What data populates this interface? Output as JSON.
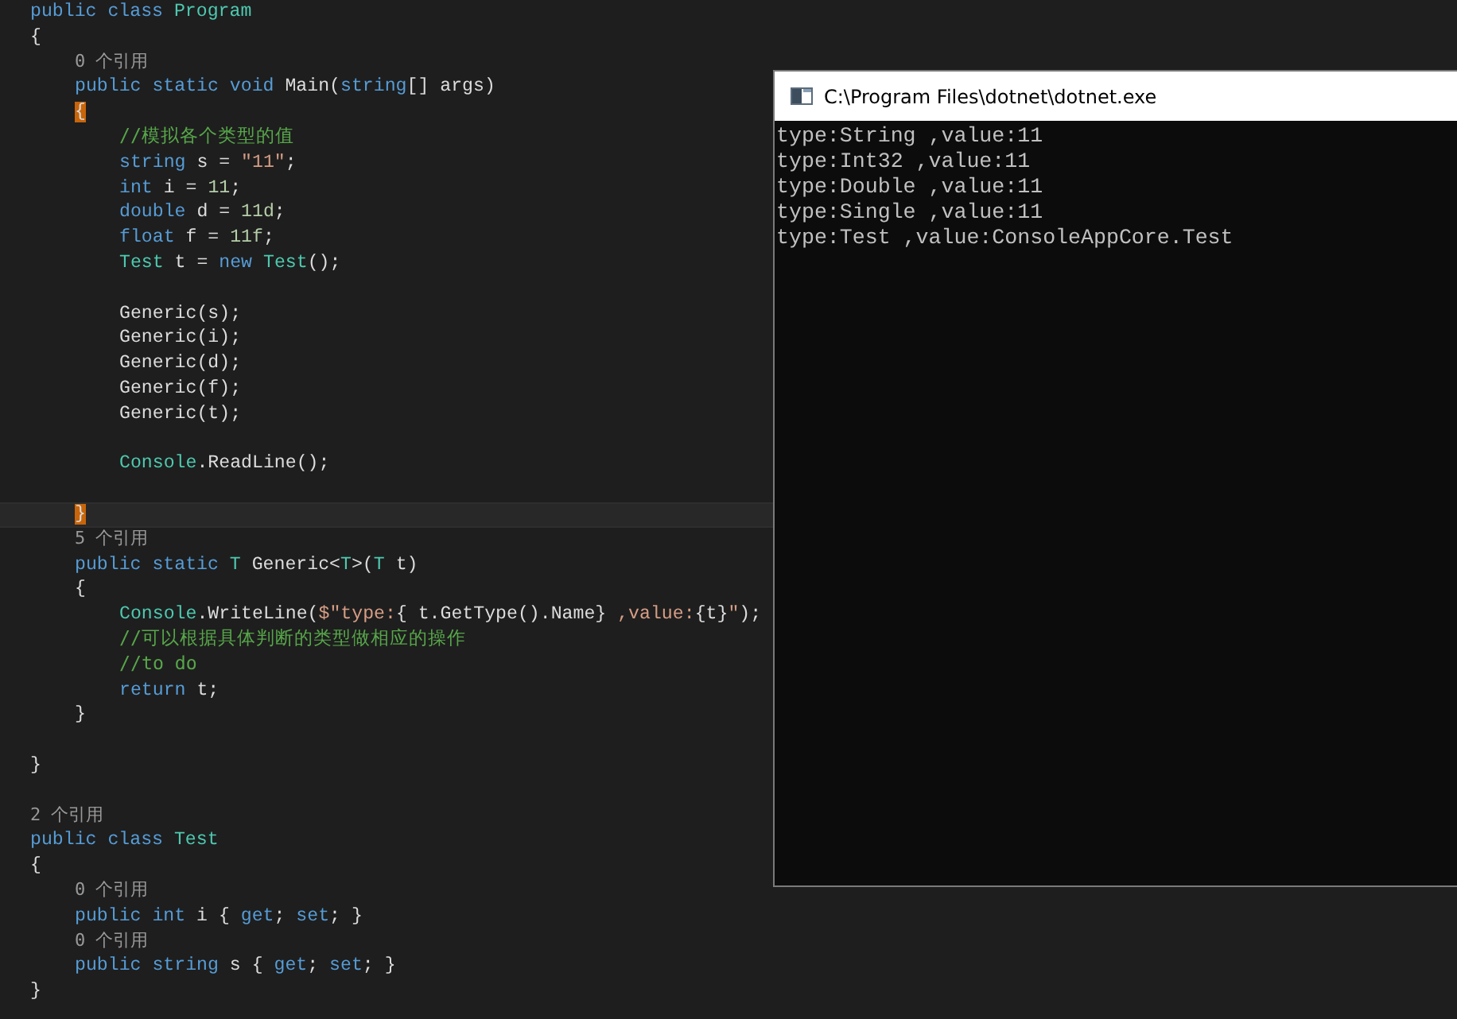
{
  "editor": {
    "lines": [
      {
        "kind": "code",
        "current": false,
        "tokens": [
          {
            "kind": "keyword",
            "text": "public class "
          },
          {
            "kind": "type",
            "text": "Program"
          }
        ]
      },
      {
        "kind": "code",
        "current": false,
        "tokens": [
          {
            "kind": "plain",
            "text": "{"
          }
        ],
        "children": [
          {
            "kind": "code",
            "current": false,
            "tokens": [
              {
                "kind": "lens",
                "text": "0 个引用"
              }
            ]
          },
          {
            "kind": "code",
            "current": false,
            "tokens": [
              {
                "kind": "keyword",
                "text": "public static void "
              },
              {
                "kind": "plain",
                "text": "Main("
              },
              {
                "kind": "keyword",
                "text": "string"
              },
              {
                "kind": "plain",
                "text": "[] args)"
              }
            ]
          },
          {
            "kind": "code",
            "current": false,
            "tokens": [
              {
                "kind": "brace-match",
                "text": "{"
              }
            ],
            "children": [
              {
                "kind": "code",
                "current": false,
                "tokens": [
                  {
                    "kind": "comment",
                    "text": "//模拟各个类型的值"
                  }
                ]
              },
              {
                "kind": "code",
                "current": false,
                "tokens": [
                  {
                    "kind": "keyword",
                    "text": "string "
                  },
                  {
                    "kind": "plain",
                    "text": "s = "
                  },
                  {
                    "kind": "string",
                    "text": "\"11\""
                  },
                  {
                    "kind": "plain",
                    "text": ";"
                  }
                ]
              },
              {
                "kind": "code",
                "current": false,
                "tokens": [
                  {
                    "kind": "keyword",
                    "text": "int "
                  },
                  {
                    "kind": "plain",
                    "text": "i = "
                  },
                  {
                    "kind": "number",
                    "text": "11"
                  },
                  {
                    "kind": "plain",
                    "text": ";"
                  }
                ]
              },
              {
                "kind": "code",
                "current": false,
                "tokens": [
                  {
                    "kind": "keyword",
                    "text": "double "
                  },
                  {
                    "kind": "plain",
                    "text": "d = "
                  },
                  {
                    "kind": "number",
                    "text": "11d"
                  },
                  {
                    "kind": "plain",
                    "text": ";"
                  }
                ]
              },
              {
                "kind": "code",
                "current": false,
                "tokens": [
                  {
                    "kind": "keyword",
                    "text": "float "
                  },
                  {
                    "kind": "plain",
                    "text": "f = "
                  },
                  {
                    "kind": "number",
                    "text": "11f"
                  },
                  {
                    "kind": "plain",
                    "text": ";"
                  }
                ]
              },
              {
                "kind": "code",
                "current": false,
                "tokens": [
                  {
                    "kind": "type",
                    "text": "Test "
                  },
                  {
                    "kind": "plain",
                    "text": "t = "
                  },
                  {
                    "kind": "keyword",
                    "text": "new "
                  },
                  {
                    "kind": "type",
                    "text": "Test"
                  },
                  {
                    "kind": "plain",
                    "text": "();"
                  }
                ]
              },
              {
                "kind": "blank",
                "current": false
              },
              {
                "kind": "code",
                "current": false,
                "tokens": [
                  {
                    "kind": "plain",
                    "text": "Generic(s);"
                  }
                ]
              },
              {
                "kind": "code",
                "current": false,
                "tokens": [
                  {
                    "kind": "plain",
                    "text": "Generic(i);"
                  }
                ]
              },
              {
                "kind": "code",
                "current": false,
                "tokens": [
                  {
                    "kind": "plain",
                    "text": "Generic(d);"
                  }
                ]
              },
              {
                "kind": "code",
                "current": false,
                "tokens": [
                  {
                    "kind": "plain",
                    "text": "Generic(f);"
                  }
                ]
              },
              {
                "kind": "code",
                "current": false,
                "tokens": [
                  {
                    "kind": "plain",
                    "text": "Generic(t);"
                  }
                ]
              },
              {
                "kind": "blank",
                "current": false
              },
              {
                "kind": "code",
                "current": false,
                "tokens": [
                  {
                    "kind": "type",
                    "text": "Console"
                  },
                  {
                    "kind": "plain",
                    "text": ".ReadLine();"
                  }
                ]
              },
              {
                "kind": "blank",
                "current": false
              }
            ]
          },
          {
            "kind": "code",
            "current": true,
            "tokens": [
              {
                "kind": "brace-match",
                "text": "}"
              }
            ]
          },
          {
            "kind": "code",
            "current": false,
            "tokens": [
              {
                "kind": "lens",
                "text": "5 个引用"
              }
            ]
          },
          {
            "kind": "code",
            "current": false,
            "tokens": [
              {
                "kind": "keyword",
                "text": "public static "
              },
              {
                "kind": "type",
                "text": "T "
              },
              {
                "kind": "plain",
                "text": "Generic<"
              },
              {
                "kind": "type",
                "text": "T"
              },
              {
                "kind": "plain",
                "text": ">("
              },
              {
                "kind": "type",
                "text": "T "
              },
              {
                "kind": "plain",
                "text": "t)"
              }
            ]
          },
          {
            "kind": "code",
            "current": false,
            "tokens": [
              {
                "kind": "plain",
                "text": "{"
              }
            ],
            "children": [
              {
                "kind": "code",
                "current": false,
                "tokens": [
                  {
                    "kind": "type",
                    "text": "Console"
                  },
                  {
                    "kind": "plain",
                    "text": ".WriteLine("
                  },
                  {
                    "kind": "string",
                    "text": "$\"type:"
                  },
                  {
                    "kind": "plain",
                    "text": "{ t.GetType().Name}"
                  },
                  {
                    "kind": "string",
                    "text": " ,value:"
                  },
                  {
                    "kind": "plain",
                    "text": "{t}"
                  },
                  {
                    "kind": "string",
                    "text": "\""
                  },
                  {
                    "kind": "plain",
                    "text": ");"
                  }
                ]
              },
              {
                "kind": "code",
                "current": false,
                "tokens": [
                  {
                    "kind": "comment",
                    "text": "//可以根据具体判断的类型做相应的操作"
                  }
                ]
              },
              {
                "kind": "code",
                "current": false,
                "tokens": [
                  {
                    "kind": "comment",
                    "text": "//to do"
                  }
                ]
              },
              {
                "kind": "code",
                "current": false,
                "tokens": [
                  {
                    "kind": "keyword",
                    "text": "return "
                  },
                  {
                    "kind": "plain",
                    "text": "t;"
                  }
                ]
              }
            ]
          },
          {
            "kind": "code",
            "current": false,
            "tokens": [
              {
                "kind": "plain",
                "text": "}"
              }
            ]
          },
          {
            "kind": "blank",
            "current": false
          }
        ]
      },
      {
        "kind": "code",
        "current": false,
        "tokens": [
          {
            "kind": "plain",
            "text": "}"
          }
        ]
      },
      {
        "kind": "blank",
        "current": false
      },
      {
        "kind": "code",
        "current": false,
        "tokens": [
          {
            "kind": "lens",
            "text": "2 个引用"
          }
        ]
      },
      {
        "kind": "code",
        "current": false,
        "tokens": [
          {
            "kind": "keyword",
            "text": "public class "
          },
          {
            "kind": "type",
            "text": "Test"
          }
        ]
      },
      {
        "kind": "code",
        "current": false,
        "tokens": [
          {
            "kind": "plain",
            "text": "{"
          }
        ],
        "children": [
          {
            "kind": "code",
            "current": false,
            "tokens": [
              {
                "kind": "lens",
                "text": "0 个引用"
              }
            ]
          },
          {
            "kind": "code",
            "current": false,
            "tokens": [
              {
                "kind": "keyword",
                "text": "public int "
              },
              {
                "kind": "plain",
                "text": "i { "
              },
              {
                "kind": "keyword",
                "text": "get"
              },
              {
                "kind": "plain",
                "text": "; "
              },
              {
                "kind": "keyword",
                "text": "set"
              },
              {
                "kind": "plain",
                "text": "; }"
              }
            ]
          },
          {
            "kind": "code",
            "current": false,
            "tokens": [
              {
                "kind": "lens",
                "text": "0 个引用"
              }
            ]
          },
          {
            "kind": "code",
            "current": false,
            "tokens": [
              {
                "kind": "keyword",
                "text": "public string "
              },
              {
                "kind": "plain",
                "text": "s { "
              },
              {
                "kind": "keyword",
                "text": "get"
              },
              {
                "kind": "plain",
                "text": "; "
              },
              {
                "kind": "keyword",
                "text": "set"
              },
              {
                "kind": "plain",
                "text": "; }"
              }
            ]
          }
        ]
      },
      {
        "kind": "code",
        "current": false,
        "tokens": [
          {
            "kind": "plain",
            "text": "}"
          }
        ]
      }
    ]
  },
  "console": {
    "title": "C:\\Program Files\\dotnet\\dotnet.exe",
    "output": [
      "type:String ,value:11",
      "type:Int32 ,value:11",
      "type:Double ,value:11",
      "type:Single ,value:11",
      "type:Test ,value:ConsoleAppCore.Test"
    ]
  }
}
